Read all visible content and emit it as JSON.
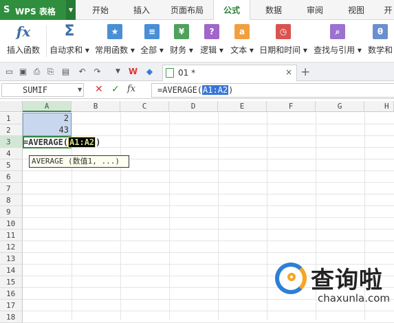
{
  "app": {
    "logo_mark": "S",
    "title": "WPS 表格",
    "dropdown": "▼"
  },
  "tabs": [
    {
      "label": "开始"
    },
    {
      "label": "插入"
    },
    {
      "label": "页面布局"
    },
    {
      "label": "公式"
    },
    {
      "label": "数据"
    },
    {
      "label": "审阅"
    },
    {
      "label": "视图"
    },
    {
      "label": "开"
    }
  ],
  "active_tab": "公式",
  "ribbon": {
    "buttons": [
      {
        "label": "插入函数",
        "icon": "fx-icon",
        "glyph": "fx"
      },
      {
        "label": "自动求和 ▾",
        "icon": "sigma-icon",
        "glyph": "Σ"
      },
      {
        "label": "常用函数 ▾",
        "icon": "star-book-icon",
        "glyph": "★"
      },
      {
        "label": "全部 ▾",
        "icon": "book-icon",
        "glyph": "≡"
      },
      {
        "label": "财务 ▾",
        "icon": "finance-book-icon",
        "glyph": "¥"
      },
      {
        "label": "逻辑 ▾",
        "icon": "logic-book-icon",
        "glyph": "?"
      },
      {
        "label": "文本 ▾",
        "icon": "text-book-icon",
        "glyph": "a"
      },
      {
        "label": "日期和时间 ▾",
        "icon": "clock-book-icon",
        "glyph": "◷"
      },
      {
        "label": "查找与引用 ▾",
        "icon": "search-book-icon",
        "glyph": "⌕"
      },
      {
        "label": "数学和",
        "icon": "math-book-icon",
        "glyph": "θ"
      }
    ],
    "colors": [
      "#3b6ea8",
      "#3b6ea8",
      "#4a8fd6",
      "#4a8fd6",
      "#4ea25a",
      "#a066c8",
      "#f0a040",
      "#d9534f",
      "#9b72cf",
      "#6a8fcf"
    ]
  },
  "quickbar": {
    "icons": [
      "folder-icon",
      "save-icon",
      "print-preview-icon",
      "print-icon",
      "export-icon",
      "undo-icon",
      "redo-icon",
      "more-icon",
      "wps-logo-icon",
      "cube-icon"
    ]
  },
  "document_tab": {
    "name": "01 *",
    "close": "×",
    "add": "+"
  },
  "formula_bar": {
    "name_box": "SUMIF",
    "cancel": "✕",
    "confirm": "✓",
    "fx": "fx",
    "formula_prefix": "=AVERAGE(",
    "formula_ref": "A1:A2",
    "formula_suffix": ")"
  },
  "grid": {
    "columns": [
      "A",
      "B",
      "C",
      "D",
      "E",
      "F",
      "G",
      "H"
    ],
    "rows": [
      "1",
      "2",
      "3",
      "4",
      "5",
      "6",
      "7",
      "8",
      "9",
      "10",
      "11",
      "12",
      "13",
      "14",
      "15",
      "16",
      "17",
      "18"
    ],
    "selected_column": "A",
    "selected_row": "3",
    "cells": {
      "A1": "2",
      "A2": "43"
    },
    "editing_cell": {
      "prefix": "=AVERAGE(",
      "ref": "A1:A2",
      "suffix": ")"
    },
    "tooltip": "AVERAGE (数值1, ...)"
  },
  "watermark": {
    "text": "查询啦",
    "domain": "chaxunla.com"
  }
}
